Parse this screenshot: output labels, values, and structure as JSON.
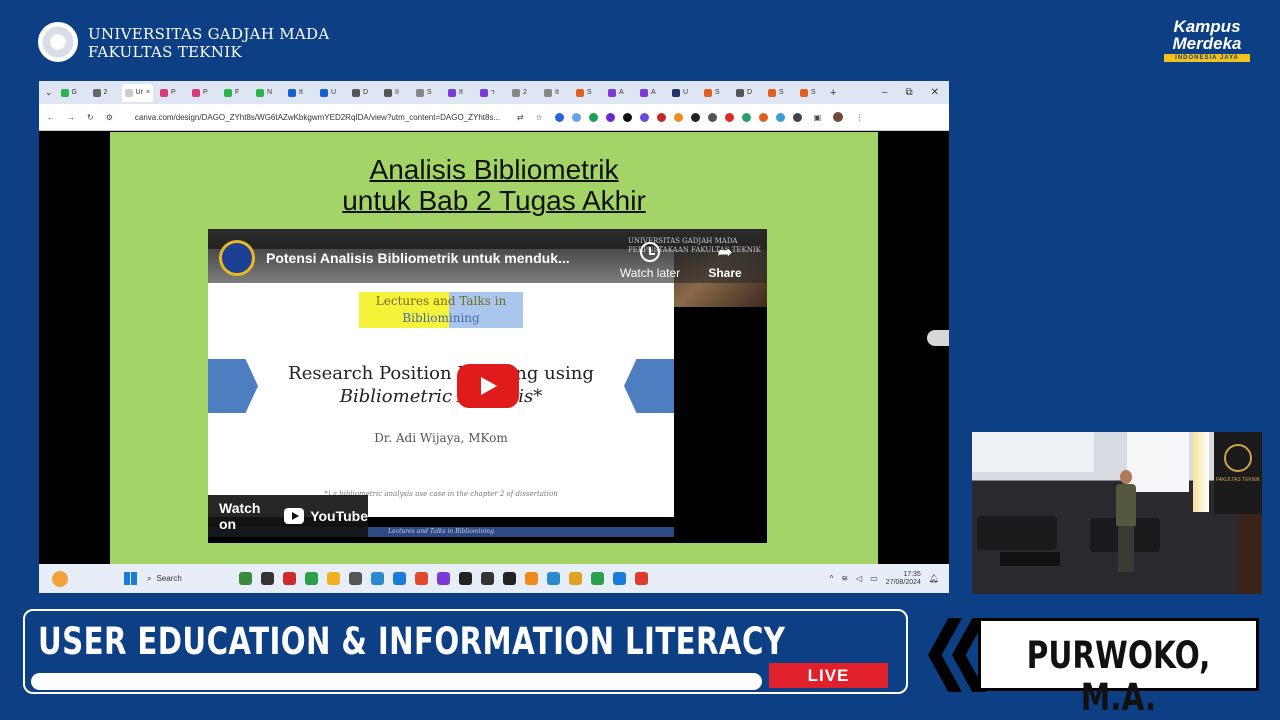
{
  "branding": {
    "university_line1": "UNIVERSITAS GADJAH MADA",
    "university_line2": "FAKULTAS TEKNIK",
    "kampus_line1": "Kampus",
    "kampus_line2": "Merdeka",
    "kampus_sub": "INDONESIA JAYA"
  },
  "browser": {
    "tabs": [
      {
        "label": "G",
        "color": "#2bb24c"
      },
      {
        "label": "2",
        "color": "#666666"
      },
      {
        "label": "Ur",
        "color": "#cccccc",
        "active": true,
        "close": "×"
      },
      {
        "label": "P",
        "color": "#d93a7a"
      },
      {
        "label": "P",
        "color": "#d93a7a"
      },
      {
        "label": "F",
        "color": "#2bb24c"
      },
      {
        "label": "N",
        "color": "#2bb24c"
      },
      {
        "label": "It",
        "color": "#1a5fd0"
      },
      {
        "label": "U",
        "color": "#1a5fd0"
      },
      {
        "label": "D",
        "color": "#555555"
      },
      {
        "label": "II",
        "color": "#555555"
      },
      {
        "label": "S",
        "color": "#888888"
      },
      {
        "label": "It",
        "color": "#7a3ad6"
      },
      {
        "label": "ר",
        "color": "#7a3ad6"
      },
      {
        "label": "2",
        "color": "#888888"
      },
      {
        "label": "It",
        "color": "#888888"
      },
      {
        "label": "S",
        "color": "#e06020"
      },
      {
        "label": "A",
        "color": "#7a3ad6"
      },
      {
        "label": "A",
        "color": "#7a3ad6"
      },
      {
        "label": "U",
        "color": "#223366"
      },
      {
        "label": "S",
        "color": "#e06020"
      },
      {
        "label": "D",
        "color": "#555555"
      },
      {
        "label": "S",
        "color": "#e06020"
      },
      {
        "label": "S",
        "color": "#e06020"
      }
    ],
    "new_tab": "+",
    "window_controls": [
      "–",
      "⧉",
      "✕"
    ],
    "nav": [
      "←",
      "→",
      "↻"
    ],
    "url": "canva.com/design/DAGO_ZYht8s/WG6tAZwKbkgwmYED2RqIDA/view?utm_content=DAGO_ZYht8s...",
    "extension_colors": [
      "#2b62d9",
      "#6aa0e8",
      "#1e9e5a",
      "#6a2ac8",
      "#111111",
      "#6b4ce0",
      "#c02a2a",
      "#f08a1a",
      "#222222",
      "#555555",
      "#e02a2a",
      "#2a9e6a",
      "#e06020",
      "#3a9ed0",
      "#444444"
    ]
  },
  "slide": {
    "title_line1": "Analisis Bibliometrik",
    "title_line2": "untuk Bab 2 Tugas Akhir"
  },
  "video": {
    "title": "Potensi Analisis Bibliometrik untuk menduk...",
    "watermark_line1": "UNIVERSITAS GADJAH MADA",
    "watermark_line2": "PERPUSTAKAAN FAKULTAS TEKNIK",
    "watch_later": "Watch later",
    "share": "Share",
    "lectures_line1": "Lectures and Talks in",
    "lectures_line2": "Bibliomining",
    "rp_line1": "Research Position Mapping using",
    "rp_line2": "Bibliometric Analysis*",
    "author": "Dr. Adi Wijaya, MKom",
    "note": "*) a bibliometric analysis use case in the chapter 2 of dissertation",
    "footer": "Lectures and Talks in Bibliomining",
    "watch_on": "Watch on",
    "youtube": "YouTube"
  },
  "taskbar": {
    "search": "Search",
    "time": "17:35",
    "date": "27/08/2024",
    "icon_colors": [
      "#3a8a3a",
      "#333333",
      "#d02a2a",
      "#2aa04a",
      "#f0b020",
      "#555555",
      "#2a8ad0",
      "#1a7bd8",
      "#e04a2a",
      "#7a3ad6",
      "#222222",
      "#333333",
      "#222222",
      "#f08a1a",
      "#2a8ad0",
      "#e0a020",
      "#2aa04a",
      "#1a7bd8",
      "#e03a2a"
    ]
  },
  "speaker_inset": {
    "banner_text": "FAKULTAS TEKNIK"
  },
  "lower_third": {
    "title": "USER EDUCATION & INFORMATION LITERACY",
    "live": "LIVE",
    "speaker_name": "PURWOKO, M.A."
  }
}
